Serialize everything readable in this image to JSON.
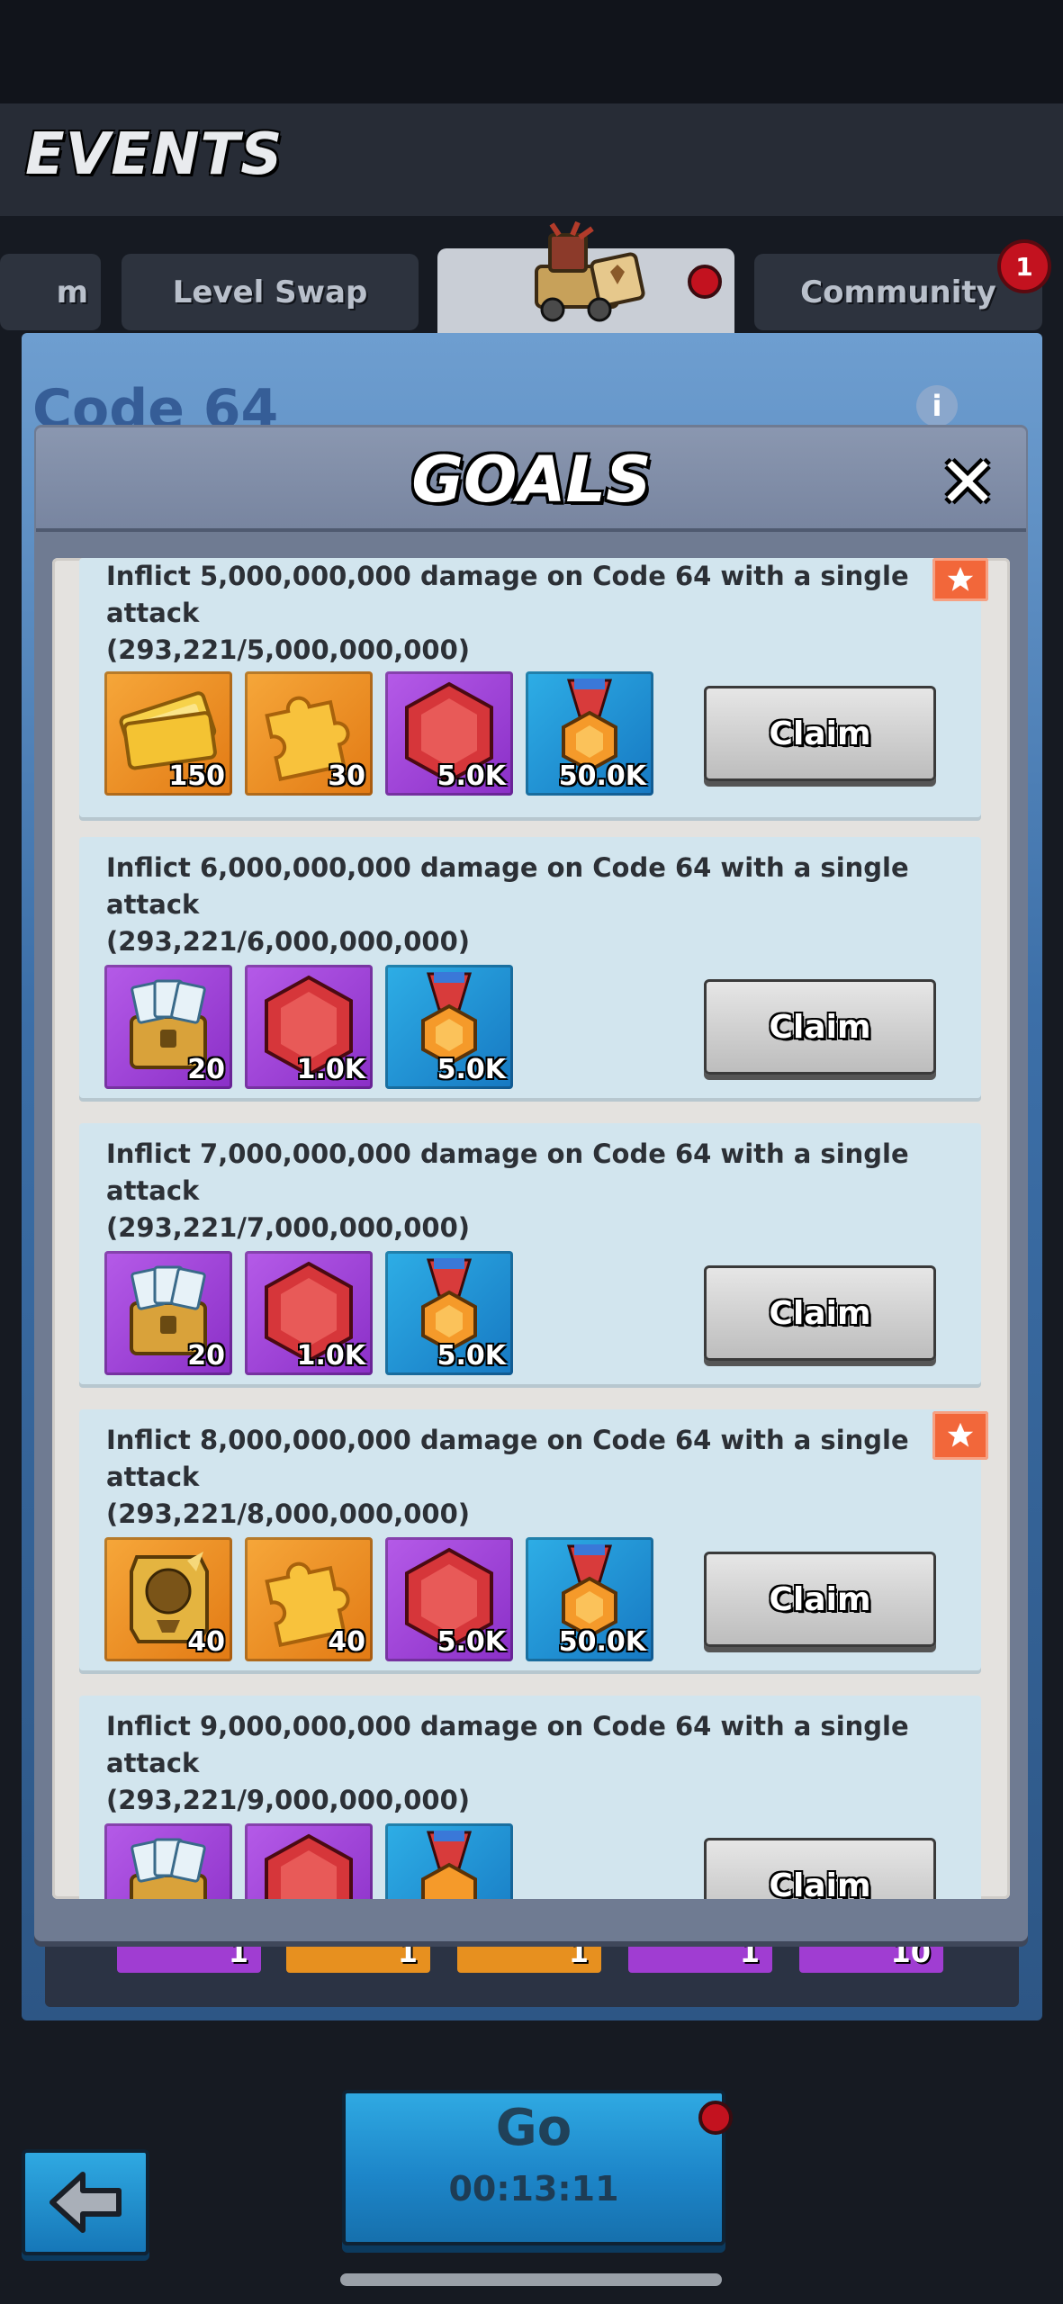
{
  "header": {
    "title": "EVENTS"
  },
  "tabs": [
    {
      "label": "m"
    },
    {
      "label": "Level Swap"
    },
    {
      "label": ""
    },
    {
      "label": "Community",
      "badge": "1"
    }
  ],
  "event": {
    "title": "Code 64",
    "info_icon": "info-icon"
  },
  "modal": {
    "title": "GOALS",
    "close_icon": "close-icon",
    "goals": [
      {
        "text": "Inflict 5,000,000,000 damage on Code 64 with a single attack\n(293,221/5,000,000,000)",
        "claim": "Claim",
        "starred": true,
        "rewards": [
          {
            "icon": "gold-ticket-icon",
            "amount": "150",
            "color": "orange"
          },
          {
            "icon": "puzzle-piece-icon",
            "amount": "30",
            "color": "orange"
          },
          {
            "icon": "ruby-gem-icon",
            "amount": "5.0K",
            "color": "purple"
          },
          {
            "icon": "medal-icon",
            "amount": "50.0K",
            "color": "blue"
          }
        ]
      },
      {
        "text": "Inflict 6,000,000,000 damage on Code 64 with a single attack\n(293,221/6,000,000,000)",
        "claim": "Claim",
        "starred": false,
        "rewards": [
          {
            "icon": "card-chest-icon",
            "amount": "20",
            "color": "purple"
          },
          {
            "icon": "ruby-gem-icon",
            "amount": "1.0K",
            "color": "purple"
          },
          {
            "icon": "medal-icon",
            "amount": "5.0K",
            "color": "blue"
          }
        ]
      },
      {
        "text": "Inflict 7,000,000,000 damage on Code 64 with a single attack\n(293,221/7,000,000,000)",
        "claim": "Claim",
        "starred": false,
        "rewards": [
          {
            "icon": "card-chest-icon",
            "amount": "20",
            "color": "purple"
          },
          {
            "icon": "ruby-gem-icon",
            "amount": "1.0K",
            "color": "purple"
          },
          {
            "icon": "medal-icon",
            "amount": "5.0K",
            "color": "blue"
          }
        ]
      },
      {
        "text": "Inflict 8,000,000,000 damage on Code 64 with a single attack\n(293,221/8,000,000,000)",
        "claim": "Claim",
        "starred": true,
        "rewards": [
          {
            "icon": "gold-token-icon",
            "amount": "40",
            "color": "orange"
          },
          {
            "icon": "puzzle-piece-icon",
            "amount": "40",
            "color": "orange"
          },
          {
            "icon": "ruby-gem-icon",
            "amount": "5.0K",
            "color": "purple"
          },
          {
            "icon": "medal-icon",
            "amount": "50.0K",
            "color": "blue"
          }
        ]
      },
      {
        "text": "Inflict 9,000,000,000 damage on Code 64 with a single attack\n(293,221/9,000,000,000)",
        "claim": "Claim",
        "starred": false,
        "rewards": [
          {
            "icon": "card-chest-icon",
            "amount": "",
            "color": "purple"
          },
          {
            "icon": "ruby-gem-icon",
            "amount": "",
            "color": "purple"
          },
          {
            "icon": "medal-icon",
            "amount": "",
            "color": "blue"
          }
        ]
      }
    ]
  },
  "background_rewards": [
    "1",
    "1",
    "1",
    "1",
    "10"
  ],
  "footer": {
    "go_label": "Go",
    "timer": "00:13:11",
    "back_icon": "back-arrow-icon"
  },
  "colors": {
    "orange_tile": "#e27a14",
    "purple_tile": "#8a2fc7",
    "blue_tile": "#1678c2",
    "card_bg": "#d2e5ee",
    "notification_red": "#c3121f"
  }
}
